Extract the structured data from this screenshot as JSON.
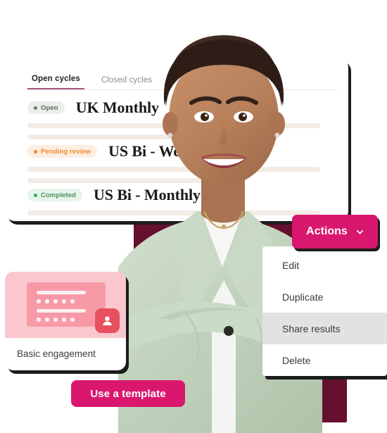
{
  "colors": {
    "brand_pink": "#d9176e",
    "maroon": "#65102f",
    "tab_underline": "#a3577e",
    "placeholder_bar": "#f2ece5",
    "menu_highlight": "#e2e2e2",
    "thumb_pink": "#fbc7cf",
    "thumb_inner_pink": "#f79aa6",
    "avatar_red": "#e8505f"
  },
  "cycles_card": {
    "tabs": [
      {
        "label": "Open cycles",
        "active": true
      },
      {
        "label": "Closed cycles",
        "active": false
      }
    ],
    "rows": [
      {
        "status": "Open",
        "status_type": "open",
        "title": "UK Monthly"
      },
      {
        "status": "Pending review",
        "status_type": "pending",
        "title": "US Bi - Weekly"
      },
      {
        "status": "Completed",
        "status_type": "completed",
        "title": "US Bi - Monthly"
      }
    ]
  },
  "actions": {
    "button_label": "Actions",
    "chevron_icon": "chevron-down-icon",
    "menu_items": [
      {
        "label": "Edit",
        "highlighted": false
      },
      {
        "label": "Duplicate",
        "highlighted": false
      },
      {
        "label": "Share results",
        "highlighted": true
      },
      {
        "label": "Delete",
        "highlighted": false
      }
    ]
  },
  "template_card": {
    "label": "Basic engagement",
    "avatar_icon": "user-contact-icon"
  },
  "use_template": {
    "label": "Use a template"
  },
  "photo": {
    "alt": "smiling woman in mint green blazer with arms crossed",
    "icon": "person-photo"
  }
}
